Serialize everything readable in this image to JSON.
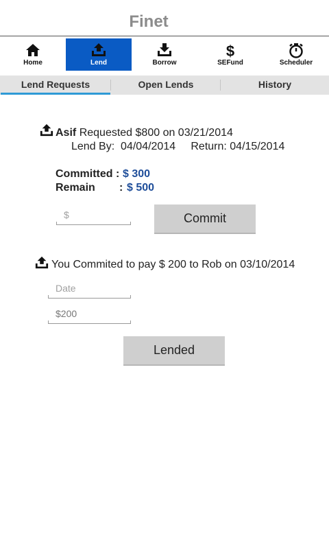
{
  "app": {
    "title": "Finet"
  },
  "nav": {
    "items": [
      {
        "label": "Home",
        "icon": "home-icon"
      },
      {
        "label": "Lend",
        "icon": "upload-tray-icon"
      },
      {
        "label": "Borrow",
        "icon": "download-tray-icon"
      },
      {
        "label": "SEFund",
        "icon": "dollar-icon"
      },
      {
        "label": "Scheduler",
        "icon": "stopwatch-icon"
      }
    ],
    "active": "Lend",
    "active_color": "#0a5bc4"
  },
  "tabs": {
    "items": [
      "Lend Requests",
      "Open Lends",
      "History"
    ],
    "active": "Lend Requests",
    "indicator_color": "#2f9ad6"
  },
  "request": {
    "name": "Asif",
    "text": "Requested $800 on 03/21/2014",
    "lend_by_label": "Lend By:",
    "lend_by_date": "04/04/2014",
    "return_label": "Return:",
    "return_date": "04/15/2014",
    "committed_label": "Committed :",
    "committed_value": "$ 300",
    "remain_label": "Remain",
    "remain_sep": ":",
    "remain_value": "$ 500",
    "amount_placeholder": "$",
    "commit_button": "Commit"
  },
  "commitment": {
    "text": "You Commited to pay $ 200 to Rob on 03/10/2014",
    "date_placeholder": "Date",
    "amount_value": "$200",
    "lended_button": "Lended"
  }
}
